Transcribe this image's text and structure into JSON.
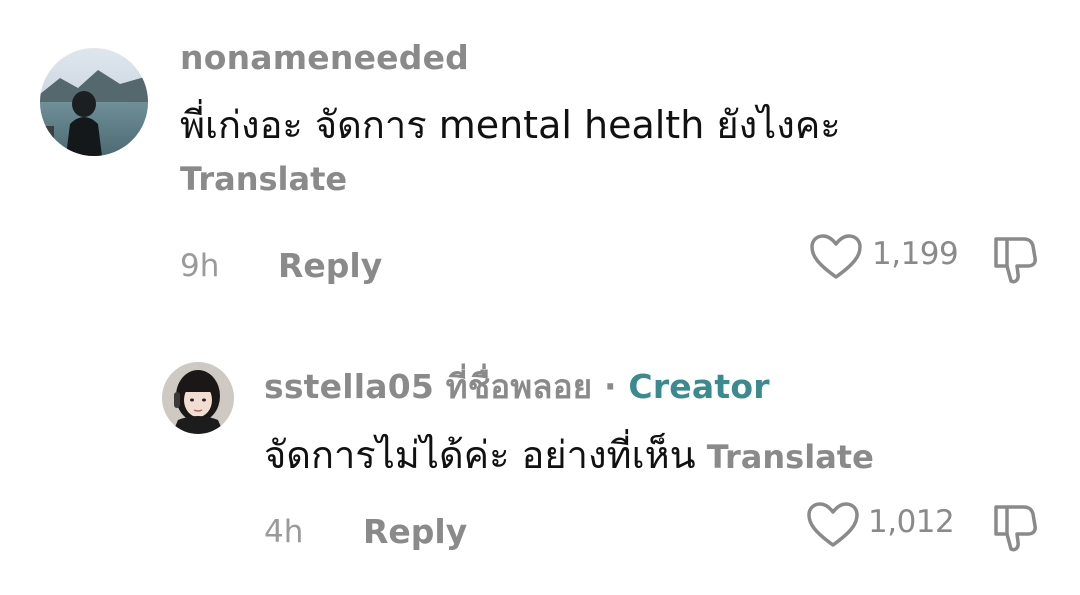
{
  "comments": [
    {
      "username": "nonameneeded",
      "text": "พี่เก่งอะ จัดการ mental health ยังไงคะ",
      "translate_label": "Translate",
      "time": "9h",
      "reply_label": "Reply",
      "like_count": "1,199"
    },
    {
      "username": "sstella05 ที่ชื่อพลอย",
      "separator": "·",
      "creator_label": "Creator",
      "text": "จัดการไม่ได้ค่ะ อย่างที่เห็น",
      "translate_label": "Translate",
      "time": "4h",
      "reply_label": "Reply",
      "like_count": "1,012"
    }
  ],
  "colors": {
    "creator": "#3a8a8f",
    "muted": "#8a8a8a",
    "text": "#111111"
  },
  "icons": [
    "heart-outline-icon",
    "dislike-thumb-icon"
  ]
}
